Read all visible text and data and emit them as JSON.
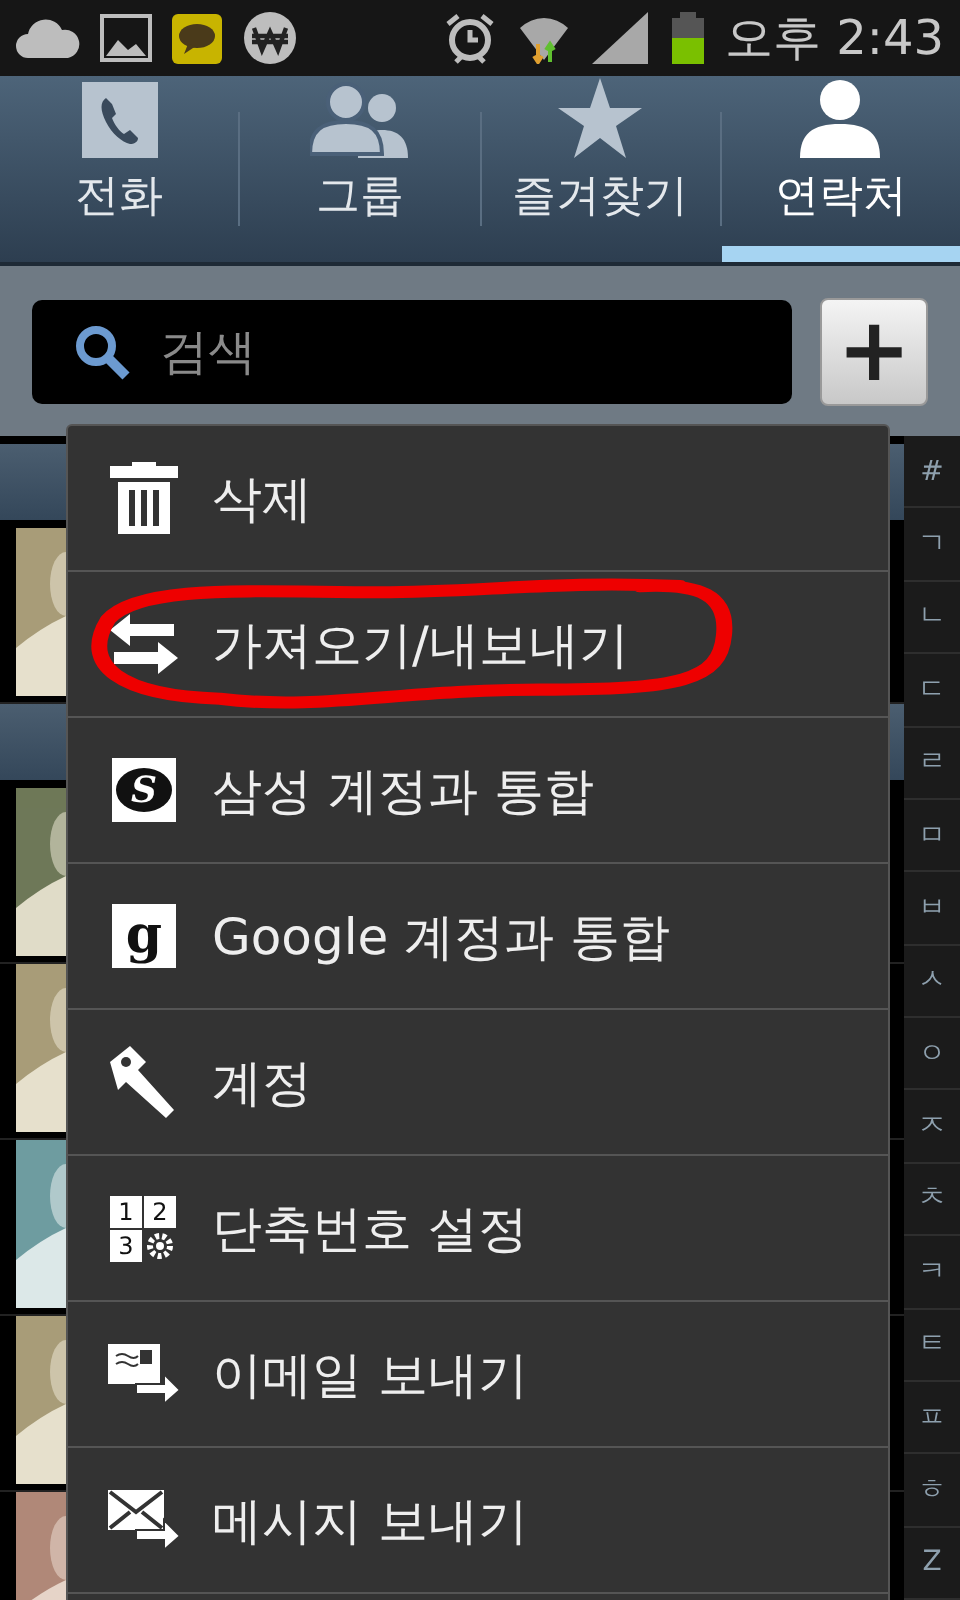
{
  "status_bar": {
    "time": "오후 2:43"
  },
  "tabs": [
    {
      "kind": "phone",
      "label": "전화",
      "selected": false
    },
    {
      "kind": "group",
      "label": "그룹",
      "selected": false
    },
    {
      "kind": "star",
      "label": "즐겨찾기",
      "selected": false
    },
    {
      "kind": "person",
      "label": "연락처",
      "selected": true
    }
  ],
  "search": {
    "placeholder": "검색",
    "add_button": "+"
  },
  "contact_list": [
    {
      "kind": "header"
    },
    {
      "kind": "picture"
    },
    {
      "kind": "header"
    },
    {
      "kind": "picture"
    },
    {
      "kind": "picture"
    },
    {
      "kind": "picture"
    },
    {
      "kind": "picture"
    },
    {
      "kind": "picture"
    }
  ],
  "index_bar": [
    "#",
    "ㄱ",
    "ㄴ",
    "ㄷ",
    "ㄹ",
    "ㅁ",
    "ㅂ",
    "ㅅ",
    "ㅇ",
    "ㅈ",
    "ㅊ",
    "ㅋ",
    "ㅌ",
    "ㅍ",
    "ㅎ",
    "Z"
  ],
  "menu": [
    {
      "kind": "trash",
      "label": "삭제",
      "circled": false
    },
    {
      "kind": "swap",
      "label": "가져오기/내보내기",
      "circled": true
    },
    {
      "kind": "badge-s",
      "icon_text": "S",
      "label": "삼성 계정과 통합",
      "circled": false
    },
    {
      "kind": "badge-g",
      "icon_text": "g",
      "label": "Google 계정과 통합",
      "circled": false
    },
    {
      "kind": "key",
      "label": "계정",
      "circled": false
    },
    {
      "kind": "grid",
      "digits": [
        "1",
        "2",
        "3"
      ],
      "label": "단축번호 설정",
      "circled": false
    },
    {
      "kind": "email",
      "label": "이메일 보내기",
      "circled": false
    },
    {
      "kind": "message",
      "label": "메시지 보내기",
      "circled": false
    }
  ]
}
